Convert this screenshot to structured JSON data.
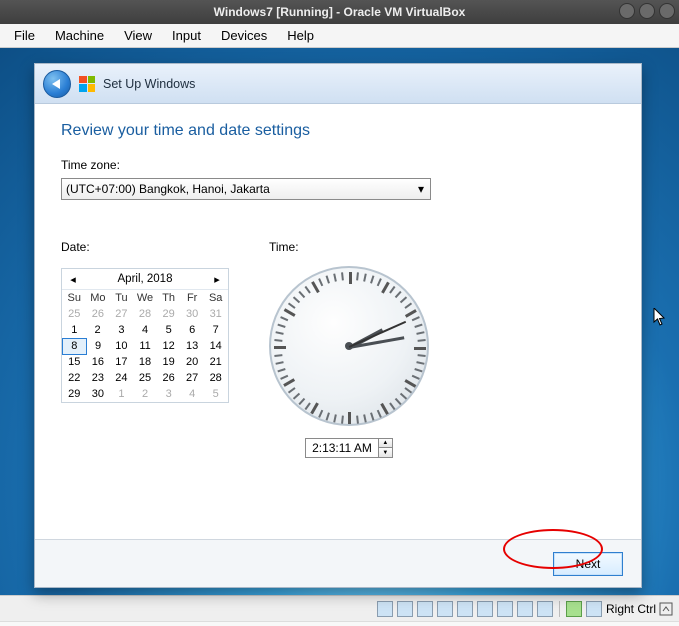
{
  "host": {
    "title": "Windows7 [Running] - Oracle VM VirtualBox",
    "menu": [
      "File",
      "Machine",
      "View",
      "Input",
      "Devices",
      "Help"
    ],
    "hostkey": "Right Ctrl"
  },
  "wizard": {
    "header": "Set Up Windows",
    "heading": "Review your time and date settings",
    "timezone_label": "Time zone:",
    "timezone_value": "(UTC+07:00) Bangkok, Hanoi, Jakarta",
    "date_label": "Date:",
    "time_label": "Time:",
    "calendar": {
      "title": "April, 2018",
      "days": [
        "Su",
        "Mo",
        "Tu",
        "We",
        "Th",
        "Fr",
        "Sa"
      ],
      "rows": [
        [
          {
            "d": "25",
            "o": true
          },
          {
            "d": "26",
            "o": true
          },
          {
            "d": "27",
            "o": true
          },
          {
            "d": "28",
            "o": true
          },
          {
            "d": "29",
            "o": true
          },
          {
            "d": "30",
            "o": true
          },
          {
            "d": "31",
            "o": true
          }
        ],
        [
          {
            "d": "1"
          },
          {
            "d": "2"
          },
          {
            "d": "3"
          },
          {
            "d": "4"
          },
          {
            "d": "5"
          },
          {
            "d": "6"
          },
          {
            "d": "7"
          }
        ],
        [
          {
            "d": "8",
            "sel": true
          },
          {
            "d": "9"
          },
          {
            "d": "10"
          },
          {
            "d": "11"
          },
          {
            "d": "12"
          },
          {
            "d": "13"
          },
          {
            "d": "14"
          }
        ],
        [
          {
            "d": "15"
          },
          {
            "d": "16"
          },
          {
            "d": "17"
          },
          {
            "d": "18"
          },
          {
            "d": "19"
          },
          {
            "d": "20"
          },
          {
            "d": "21"
          }
        ],
        [
          {
            "d": "22"
          },
          {
            "d": "23"
          },
          {
            "d": "24"
          },
          {
            "d": "25"
          },
          {
            "d": "26"
          },
          {
            "d": "27"
          },
          {
            "d": "28"
          }
        ],
        [
          {
            "d": "29"
          },
          {
            "d": "30"
          },
          {
            "d": "1",
            "o": true
          },
          {
            "d": "2",
            "o": true
          },
          {
            "d": "3",
            "o": true
          },
          {
            "d": "4",
            "o": true
          },
          {
            "d": "5",
            "o": true
          }
        ]
      ]
    },
    "time_value": "2:13:11 AM",
    "clock": {
      "hour_angle": 62,
      "minute_angle": 80,
      "second_angle": 66
    },
    "next_label": "Next"
  }
}
